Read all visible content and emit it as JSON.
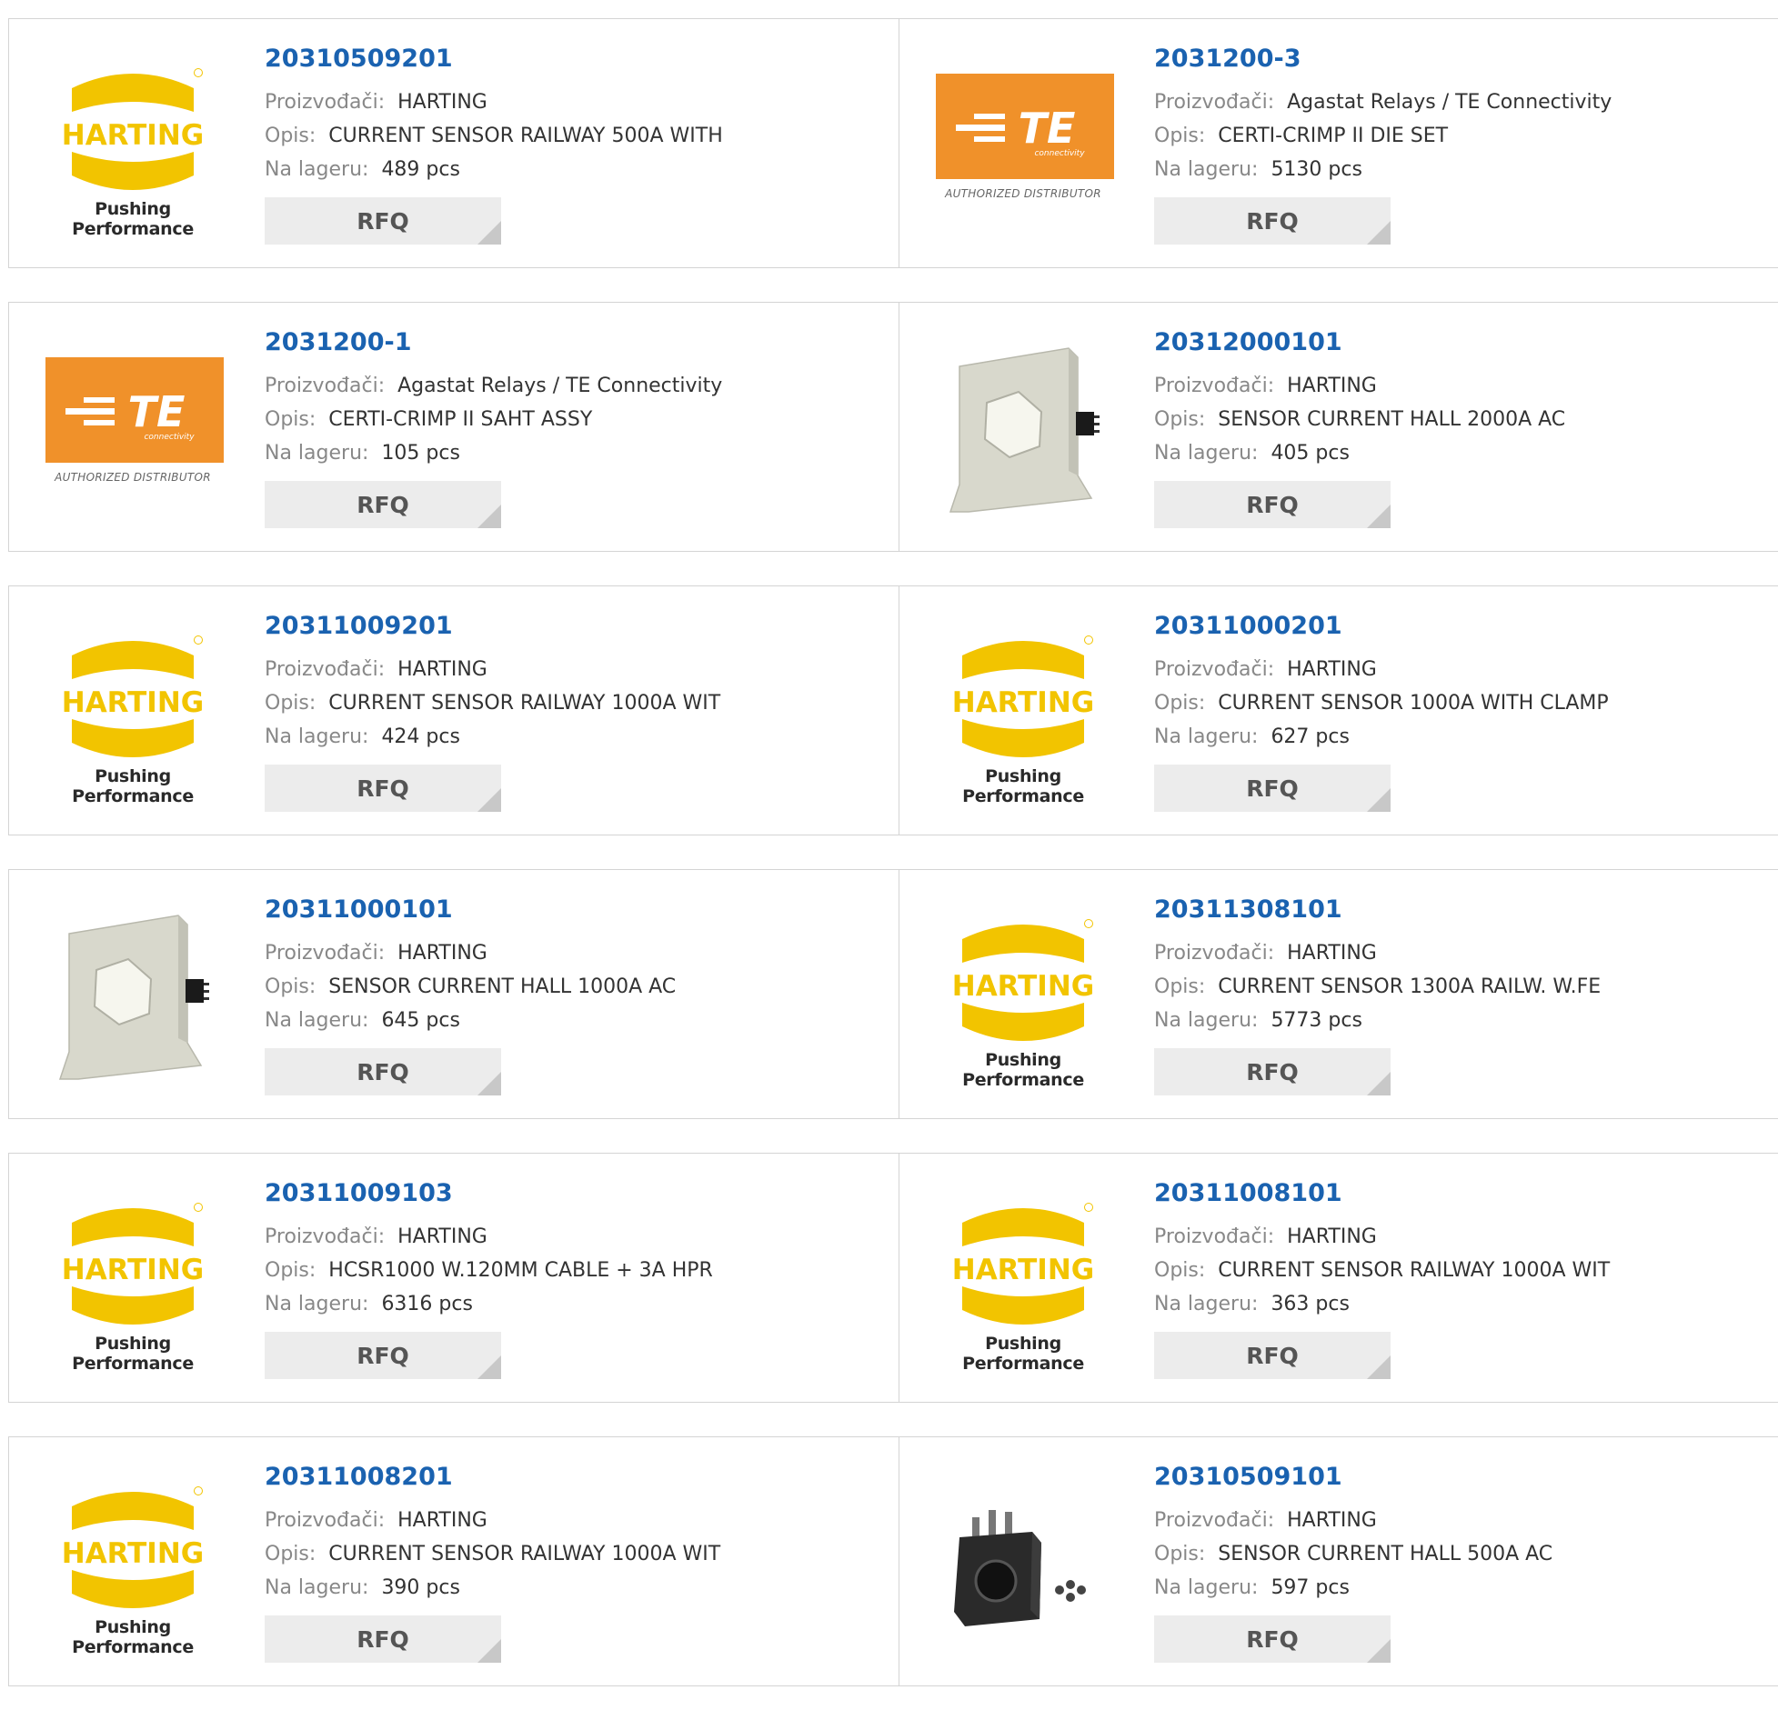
{
  "labels": {
    "manufacturer": "Proizvođači:",
    "description": "Opis:",
    "stock": "Na lageru:",
    "rfq": "RFQ"
  },
  "logos": {
    "harting_text": "HARTING",
    "harting_tagline": "Pushing Performance",
    "te_text": "TE",
    "te_sub": "connectivity",
    "te_distributor": "AUTHORIZED DISTRIBUTOR"
  },
  "colors": {
    "link": "#1a62b0",
    "harting_yellow": "#f2c400",
    "te_orange": "#f0912a"
  },
  "products": [
    {
      "pn": "20310509201",
      "mfr": "HARTING",
      "desc": "CURRENT SENSOR RAILWAY 500A WITH",
      "stock": "489 pcs",
      "image": "harting-logo"
    },
    {
      "pn": "2031200-3",
      "mfr": "Agastat Relays / TE Connectivity",
      "desc": "CERTI-CRIMP II DIE SET",
      "stock": "5130 pcs",
      "image": "te-logo"
    },
    {
      "pn": "2031200-1",
      "mfr": "Agastat Relays / TE Connectivity",
      "desc": "CERTI-CRIMP II SAHT ASSY",
      "stock": "105 pcs",
      "image": "te-logo"
    },
    {
      "pn": "20312000101",
      "mfr": "HARTING",
      "desc": "SENSOR CURRENT HALL 2000A AC",
      "stock": "405 pcs",
      "image": "hall-sensor-photo"
    },
    {
      "pn": "20311009201",
      "mfr": "HARTING",
      "desc": "CURRENT SENSOR RAILWAY 1000A WIT",
      "stock": "424 pcs",
      "image": "harting-logo"
    },
    {
      "pn": "20311000201",
      "mfr": "HARTING",
      "desc": "CURRENT SENSOR 1000A WITH CLAMP",
      "stock": "627 pcs",
      "image": "harting-logo"
    },
    {
      "pn": "20311000101",
      "mfr": "HARTING",
      "desc": "SENSOR CURRENT HALL 1000A AC",
      "stock": "645 pcs",
      "image": "hall-sensor-photo"
    },
    {
      "pn": "20311308101",
      "mfr": "HARTING",
      "desc": "CURRENT SENSOR 1300A RAILW. W.FE",
      "stock": "5773 pcs",
      "image": "harting-logo"
    },
    {
      "pn": "20311009103",
      "mfr": "HARTING",
      "desc": "HCSR1000 W.120MM CABLE + 3A HPR",
      "stock": "6316 pcs",
      "image": "harting-logo"
    },
    {
      "pn": "20311008101",
      "mfr": "HARTING",
      "desc": "CURRENT SENSOR RAILWAY 1000A WIT",
      "stock": "363 pcs",
      "image": "harting-logo"
    },
    {
      "pn": "20311008201",
      "mfr": "HARTING",
      "desc": "CURRENT SENSOR RAILWAY 1000A WIT",
      "stock": "390 pcs",
      "image": "harting-logo"
    },
    {
      "pn": "20310509101",
      "mfr": "HARTING",
      "desc": "SENSOR CURRENT HALL 500A AC",
      "stock": "597 pcs",
      "image": "black-sensor-photo"
    }
  ]
}
